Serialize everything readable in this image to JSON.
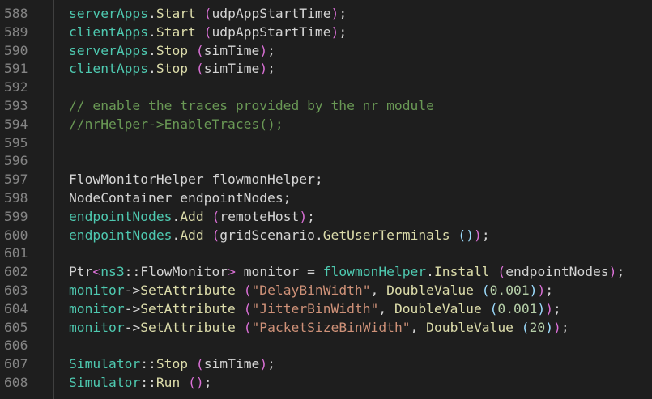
{
  "editor": {
    "lines": [
      {
        "num": "588",
        "tokens": [
          [
            "t-fn",
            "serverApps"
          ],
          [
            "t-pl",
            "."
          ],
          [
            "t-m",
            "Start"
          ],
          [
            "t-pl",
            " "
          ],
          [
            "t-par",
            "("
          ],
          [
            "t-pl",
            "udpAppStartTime"
          ],
          [
            "t-par",
            ")"
          ],
          [
            "t-pl",
            ";"
          ]
        ]
      },
      {
        "num": "589",
        "tokens": [
          [
            "t-fn",
            "clientApps"
          ],
          [
            "t-pl",
            "."
          ],
          [
            "t-m",
            "Start"
          ],
          [
            "t-pl",
            " "
          ],
          [
            "t-par",
            "("
          ],
          [
            "t-pl",
            "udpAppStartTime"
          ],
          [
            "t-par",
            ")"
          ],
          [
            "t-pl",
            ";"
          ]
        ]
      },
      {
        "num": "590",
        "tokens": [
          [
            "t-fn",
            "serverApps"
          ],
          [
            "t-pl",
            "."
          ],
          [
            "t-m",
            "Stop"
          ],
          [
            "t-pl",
            " "
          ],
          [
            "t-par",
            "("
          ],
          [
            "t-pl",
            "simTime"
          ],
          [
            "t-par",
            ")"
          ],
          [
            "t-pl",
            ";"
          ]
        ]
      },
      {
        "num": "591",
        "tokens": [
          [
            "t-fn",
            "clientApps"
          ],
          [
            "t-pl",
            "."
          ],
          [
            "t-m",
            "Stop"
          ],
          [
            "t-pl",
            " "
          ],
          [
            "t-par",
            "("
          ],
          [
            "t-pl",
            "simTime"
          ],
          [
            "t-par",
            ")"
          ],
          [
            "t-pl",
            ";"
          ]
        ]
      },
      {
        "num": "592",
        "tokens": []
      },
      {
        "num": "593",
        "tokens": [
          [
            "t-com",
            "// enable the traces provided by the nr module"
          ]
        ]
      },
      {
        "num": "594",
        "tokens": [
          [
            "t-com",
            "//nrHelper->EnableTraces();"
          ]
        ]
      },
      {
        "num": "595",
        "tokens": []
      },
      {
        "num": "596",
        "tokens": []
      },
      {
        "num": "597",
        "tokens": [
          [
            "t-pl",
            "FlowMonitorHelper flowmonHelper;"
          ]
        ]
      },
      {
        "num": "598",
        "tokens": [
          [
            "t-pl",
            "NodeContainer endpointNodes;"
          ]
        ]
      },
      {
        "num": "599",
        "tokens": [
          [
            "t-fn",
            "endpointNodes"
          ],
          [
            "t-pl",
            "."
          ],
          [
            "t-m",
            "Add"
          ],
          [
            "t-pl",
            " "
          ],
          [
            "t-par",
            "("
          ],
          [
            "t-pl",
            "remoteHost"
          ],
          [
            "t-par",
            ")"
          ],
          [
            "t-pl",
            ";"
          ]
        ]
      },
      {
        "num": "600",
        "tokens": [
          [
            "t-fn",
            "endpointNodes"
          ],
          [
            "t-pl",
            "."
          ],
          [
            "t-m",
            "Add"
          ],
          [
            "t-pl",
            " "
          ],
          [
            "t-par",
            "("
          ],
          [
            "t-pl",
            "gridScenario"
          ],
          [
            "t-pl",
            "."
          ],
          [
            "t-m",
            "GetUserTerminals"
          ],
          [
            "t-pl",
            " "
          ],
          [
            "t-var",
            "()"
          ],
          [
            "t-par",
            ")"
          ],
          [
            "t-pl",
            ";"
          ]
        ]
      },
      {
        "num": "601",
        "tokens": []
      },
      {
        "num": "602",
        "tokens": [
          [
            "t-pl",
            "Ptr"
          ],
          [
            "t-par",
            "<"
          ],
          [
            "t-fn",
            "ns3"
          ],
          [
            "t-pl",
            "::FlowMonitor"
          ],
          [
            "t-par",
            ">"
          ],
          [
            "t-pl",
            " monitor = "
          ],
          [
            "t-fn",
            "flowmonHelper"
          ],
          [
            "t-pl",
            "."
          ],
          [
            "t-m",
            "Install"
          ],
          [
            "t-pl",
            " "
          ],
          [
            "t-par",
            "("
          ],
          [
            "t-pl",
            "endpointNodes"
          ],
          [
            "t-par",
            ")"
          ],
          [
            "t-pl",
            ";"
          ]
        ]
      },
      {
        "num": "603",
        "tokens": [
          [
            "t-fn",
            "monitor"
          ],
          [
            "t-pl",
            "->"
          ],
          [
            "t-m",
            "SetAttribute"
          ],
          [
            "t-pl",
            " "
          ],
          [
            "t-par",
            "("
          ],
          [
            "t-str",
            "\"DelayBinWidth\""
          ],
          [
            "t-pl",
            ", "
          ],
          [
            "t-m",
            "DoubleValue"
          ],
          [
            "t-pl",
            " "
          ],
          [
            "t-var",
            "("
          ],
          [
            "t-num",
            "0.001"
          ],
          [
            "t-var",
            ")"
          ],
          [
            "t-par",
            ")"
          ],
          [
            "t-pl",
            ";"
          ]
        ]
      },
      {
        "num": "604",
        "tokens": [
          [
            "t-fn",
            "monitor"
          ],
          [
            "t-pl",
            "->"
          ],
          [
            "t-m",
            "SetAttribute"
          ],
          [
            "t-pl",
            " "
          ],
          [
            "t-par",
            "("
          ],
          [
            "t-str",
            "\"JitterBinWidth\""
          ],
          [
            "t-pl",
            ", "
          ],
          [
            "t-m",
            "DoubleValue"
          ],
          [
            "t-pl",
            " "
          ],
          [
            "t-var",
            "("
          ],
          [
            "t-num",
            "0.001"
          ],
          [
            "t-var",
            ")"
          ],
          [
            "t-par",
            ")"
          ],
          [
            "t-pl",
            ";"
          ]
        ]
      },
      {
        "num": "605",
        "tokens": [
          [
            "t-fn",
            "monitor"
          ],
          [
            "t-pl",
            "->"
          ],
          [
            "t-m",
            "SetAttribute"
          ],
          [
            "t-pl",
            " "
          ],
          [
            "t-par",
            "("
          ],
          [
            "t-str",
            "\"PacketSizeBinWidth\""
          ],
          [
            "t-pl",
            ", "
          ],
          [
            "t-m",
            "DoubleValue"
          ],
          [
            "t-pl",
            " "
          ],
          [
            "t-var",
            "("
          ],
          [
            "t-num",
            "20"
          ],
          [
            "t-var",
            ")"
          ],
          [
            "t-par",
            ")"
          ],
          [
            "t-pl",
            ";"
          ]
        ]
      },
      {
        "num": "606",
        "tokens": []
      },
      {
        "num": "607",
        "tokens": [
          [
            "t-fn",
            "Simulator"
          ],
          [
            "t-pl",
            "::"
          ],
          [
            "t-m",
            "Stop"
          ],
          [
            "t-pl",
            " "
          ],
          [
            "t-par",
            "("
          ],
          [
            "t-pl",
            "simTime"
          ],
          [
            "t-par",
            ")"
          ],
          [
            "t-pl",
            ";"
          ]
        ]
      },
      {
        "num": "608",
        "tokens": [
          [
            "t-fn",
            "Simulator"
          ],
          [
            "t-pl",
            "::"
          ],
          [
            "t-m",
            "Run"
          ],
          [
            "t-pl",
            " "
          ],
          [
            "t-par",
            "()"
          ],
          [
            "t-pl",
            ";"
          ]
        ]
      }
    ]
  }
}
